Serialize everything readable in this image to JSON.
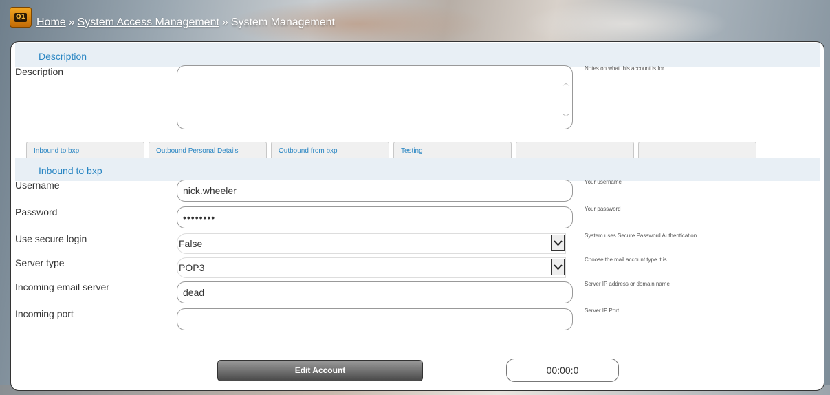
{
  "logo": {
    "text": "Q1"
  },
  "breadcrumb": {
    "items": [
      "Home",
      "System Access Management",
      "System Management"
    ],
    "separator": "»"
  },
  "description_section": {
    "header": "Description",
    "label": "Description",
    "value": "",
    "hint": "Notes on what this account is for"
  },
  "tabs": [
    {
      "label": "Inbound to bxp",
      "active": true
    },
    {
      "label": "Outbound Personal Details",
      "active": false
    },
    {
      "label": "Outbound from bxp",
      "active": false
    },
    {
      "label": "Testing",
      "active": false
    },
    {
      "label": "",
      "active": false
    },
    {
      "label": "",
      "active": false
    }
  ],
  "inbound_section": {
    "header": "Inbound to bxp",
    "fields": {
      "username": {
        "label": "Username",
        "value": "nick.wheeler",
        "hint": "Your username"
      },
      "password": {
        "label": "Password",
        "value": "••••••••",
        "hint": "Your password"
      },
      "secure_login": {
        "label": "Use secure login",
        "value": "False",
        "hint": "System uses Secure Password Authentication"
      },
      "server_type": {
        "label": "Server type",
        "value": "POP3",
        "hint": "Choose the mail account type it is"
      },
      "incoming_server": {
        "label": "Incoming email server",
        "value": "dead",
        "hint": "Server IP address or domain name"
      },
      "incoming_port": {
        "label": "Incoming port",
        "value": "",
        "hint": "Server IP Port"
      }
    }
  },
  "actions": {
    "edit_label": "Edit Account",
    "timer": "00:00:0"
  },
  "colors": {
    "accent": "#2a86c3",
    "section_bg": "#e8eff5",
    "logo": "#e08a14"
  }
}
